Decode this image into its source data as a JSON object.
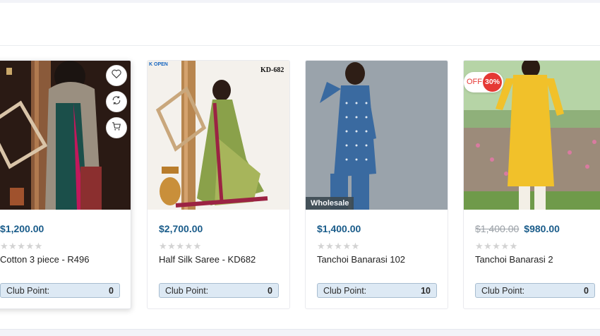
{
  "products": [
    {
      "name": "Cotton 3 piece - R496",
      "price": "$1,200.00",
      "old_price": "",
      "stars": "★★★★★",
      "club_label": "Club Point:",
      "club_points": "0"
    },
    {
      "name": "Half Silk Saree - KD682",
      "price": "$2,700.00",
      "old_price": "",
      "stars": "★★★★★",
      "club_label": "Club Point:",
      "club_points": "0",
      "image_tag": "KD-682",
      "logo_text": "K OPEN"
    },
    {
      "name": "Tanchoi Banarasi 102",
      "price": "$1,400.00",
      "old_price": "",
      "stars": "★★★★★",
      "club_label": "Club Point:",
      "club_points": "10",
      "badge": "Wholesale"
    },
    {
      "name": "Tanchoi Banarasi 2",
      "price": "$980.00",
      "old_price": "$1,400.00",
      "stars": "★★★★★",
      "club_label": "Club Point:",
      "club_points": "0",
      "discount_off": "OFF",
      "discount_pct": "30%"
    }
  ],
  "actions": {
    "wishlist_icon": "heart-icon",
    "compare_icon": "compare-icon",
    "cart_icon": "cart-icon"
  },
  "colors": {
    "price": "#1a5c8a",
    "club_bg": "#dde9f4",
    "discount": "#e53935",
    "wholesale_bg": "#3d4b53"
  }
}
